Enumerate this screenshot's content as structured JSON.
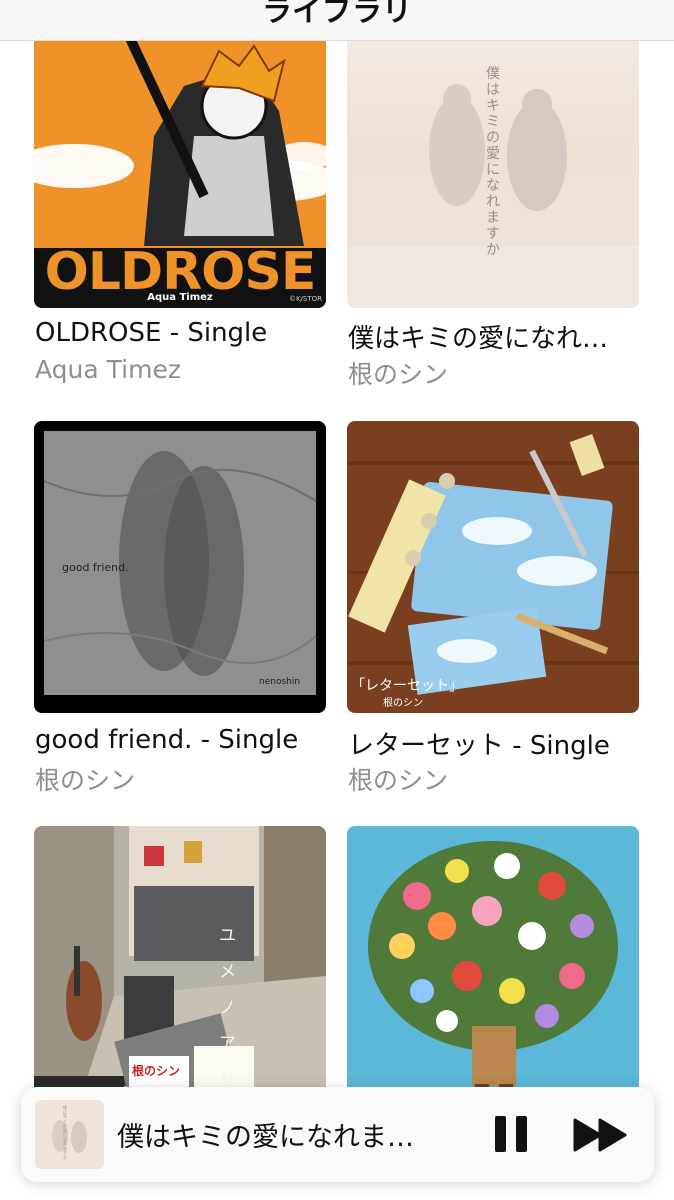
{
  "nav": {
    "title": "ライブラリ"
  },
  "albums": [
    {
      "title": "OLDROSE - Single",
      "artist": "Aqua Timez",
      "art_wordmark": "OLDROSE",
      "art_caption": "Aqua Timez",
      "art_credit": "©K/STOR"
    },
    {
      "title": "僕はキミの愛になれ…",
      "artist": "根のシン",
      "art_text": "僕はキミの愛になれますか"
    },
    {
      "title": "good friend. - Single",
      "artist": "根のシン",
      "art_text": "good friend.",
      "art_signature": "nenoshin"
    },
    {
      "title": "レターセット - Single",
      "artist": "根のシン",
      "art_text": "「レターセット」",
      "art_sub": "根のシン"
    },
    {
      "title": "",
      "artist": "",
      "art_text": "ユメノアリ",
      "art_sign": "根のシン"
    },
    {
      "title": "",
      "artist": ""
    }
  ],
  "now_playing": {
    "title": "僕はキミの愛になれま…",
    "art_text": "僕はキミの愛になれますか"
  },
  "colors": {
    "accent_orange": "#f0922a",
    "sky_blue": "#5bb8d8",
    "player_bg": "#f9f9f9"
  }
}
